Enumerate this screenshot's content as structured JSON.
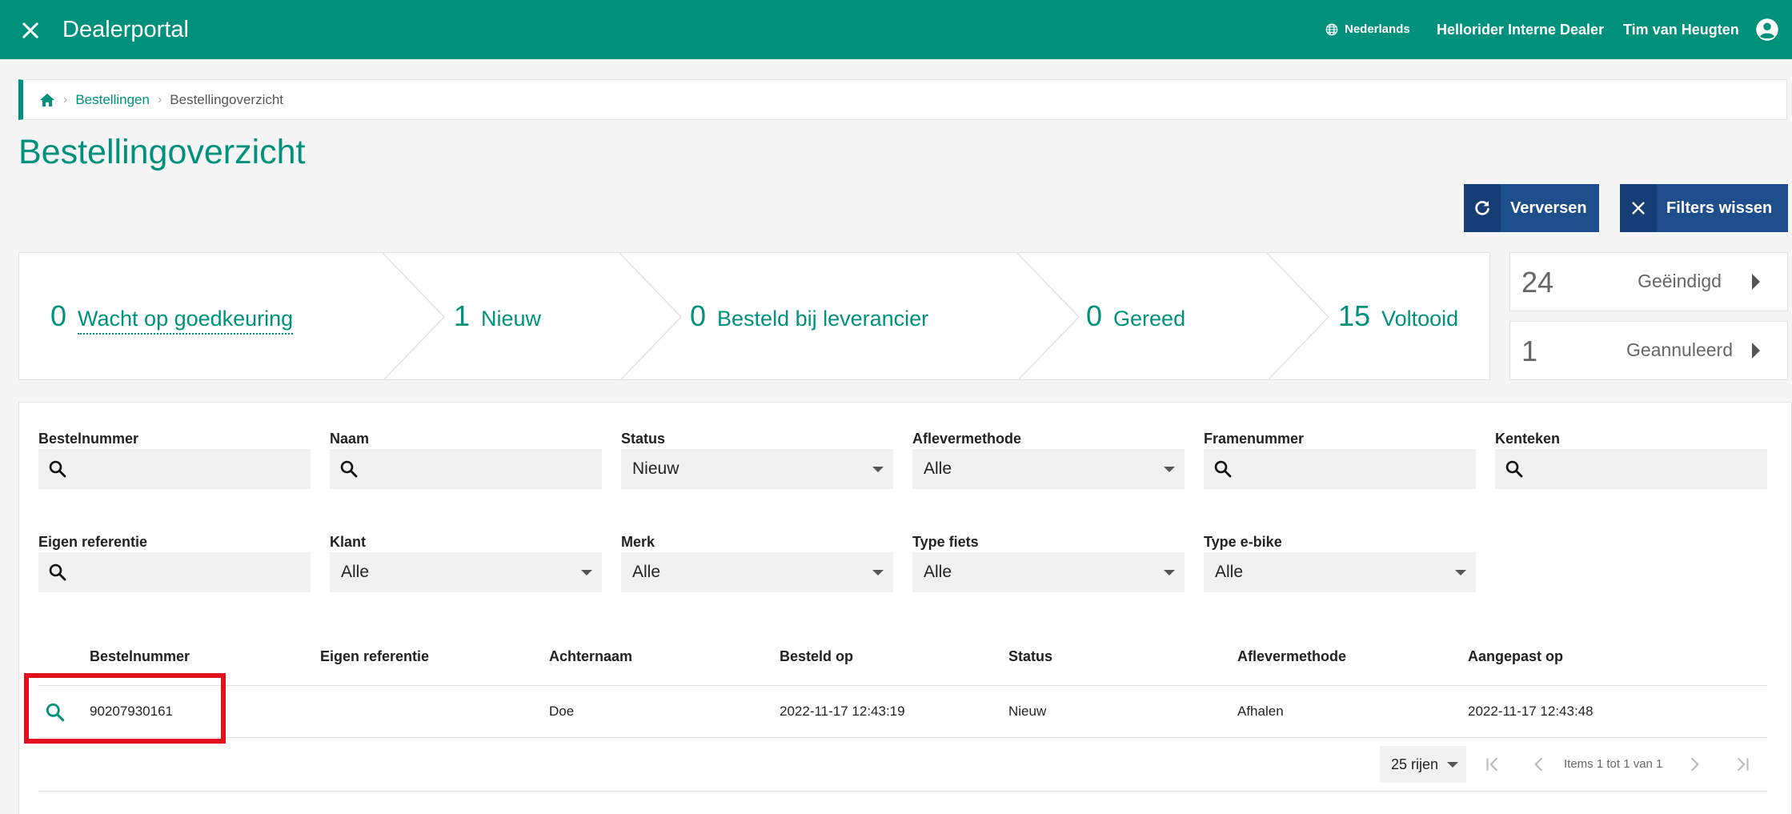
{
  "header": {
    "app_title": "Dealerportal",
    "language": "Nederlands",
    "dealer": "Hellorider Interne Dealer",
    "user": "Tim van Heugten"
  },
  "breadcrumb": {
    "items": [
      "Bestellingen",
      "Bestellingoverzicht"
    ]
  },
  "page_title": "Bestellingoverzicht",
  "toolbar": {
    "refresh_label": "Verversen",
    "clear_filters_label": "Filters wissen"
  },
  "status_stages": [
    {
      "count": "0",
      "label": "Wacht op goedkeuring"
    },
    {
      "count": "1",
      "label": "Nieuw"
    },
    {
      "count": "0",
      "label": "Besteld bij leverancier"
    },
    {
      "count": "0",
      "label": "Gereed"
    },
    {
      "count": "15",
      "label": "Voltooid"
    }
  ],
  "side_cards": [
    {
      "count": "24",
      "label": "Geëindigd"
    },
    {
      "count": "1",
      "label": "Geannuleerd"
    }
  ],
  "filters": {
    "bestelnummer": {
      "label": "Bestelnummer",
      "value": ""
    },
    "naam": {
      "label": "Naam",
      "value": ""
    },
    "status": {
      "label": "Status",
      "value": "Nieuw"
    },
    "aflevermethode": {
      "label": "Aflevermethode",
      "value": "Alle"
    },
    "framenummer": {
      "label": "Framenummer",
      "value": ""
    },
    "kenteken": {
      "label": "Kenteken",
      "value": ""
    },
    "eigen_referentie": {
      "label": "Eigen referentie",
      "value": ""
    },
    "klant": {
      "label": "Klant",
      "value": "Alle"
    },
    "merk": {
      "label": "Merk",
      "value": "Alle"
    },
    "type_fiets": {
      "label": "Type fiets",
      "value": "Alle"
    },
    "type_ebike": {
      "label": "Type e-bike",
      "value": "Alle"
    }
  },
  "table": {
    "columns": [
      "Bestelnummer",
      "Eigen referentie",
      "Achternaam",
      "Besteld op",
      "Status",
      "Aflevermethode",
      "Aangepast op"
    ],
    "rows": [
      {
        "bestelnummer": "90207930161",
        "eigen_referentie": "",
        "achternaam": "Doe",
        "besteld_op": "2022-11-17 12:43:19",
        "status": "Nieuw",
        "aflevermethode": "Afhalen",
        "aangepast_op": "2022-11-17 12:43:48"
      }
    ]
  },
  "pagination": {
    "rows_per_page": "25 rijen",
    "info": "Items 1 tot 1 van 1"
  },
  "colors": {
    "brand": "#00917c",
    "button": "#1f4e8c",
    "highlight": "#e0101c"
  }
}
